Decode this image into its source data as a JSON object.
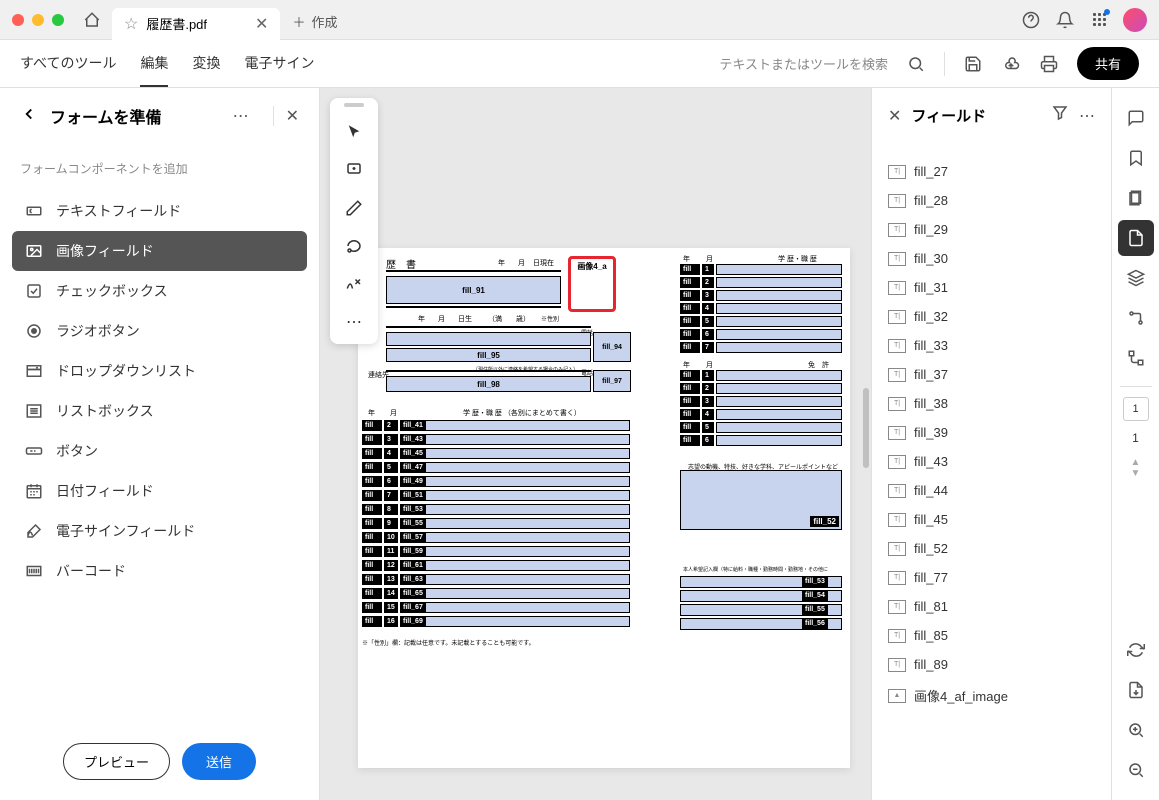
{
  "titlebar": {
    "tab_title": "履歴書.pdf",
    "new_tab_label": "作成"
  },
  "toolbar": {
    "menu": [
      "すべてのツール",
      "編集",
      "変換",
      "電子サイン"
    ],
    "search_placeholder": "テキストまたはツールを検索",
    "share_label": "共有"
  },
  "left_panel": {
    "title": "フォームを準備",
    "section_label": "フォームコンポーネントを追加",
    "components": [
      "テキストフィールド",
      "画像フィールド",
      "チェックボックス",
      "ラジオボタン",
      "ドロップダウンリスト",
      "リストボックス",
      "ボタン",
      "日付フィールド",
      "電子サインフィールド",
      "バーコード"
    ],
    "preview_label": "プレビュー",
    "submit_label": "送信"
  },
  "canvas": {
    "doc_title": "歴　書",
    "header_labels": {
      "year": "年",
      "month": "月",
      "day": "日現在",
      "birth": "日生",
      "age": "（満　　歳）",
      "tel": "連絡先",
      "note": "（現住所以外に連絡を希望する場合のみ記入）"
    },
    "section_labels": {
      "history": "学 歴・職 歴 （各別にまとめて書く）",
      "history2": "学 歴・職 歴",
      "license": "免　許",
      "motivation": "志望の動機、特技、好きな学科、アピールポイントなど",
      "requests": "本人希望記入欄（特に給料・職種・勤務時間・勤務地・その他に",
      "footnote": "※「性別」欄：記載は任意です。未記載とすることも可能です。"
    },
    "fields": {
      "f91": "fill_91",
      "f95": "fill_95",
      "f98": "fill_98",
      "f94": "fill_94",
      "f97": "fill_97",
      "f52": "fill_52",
      "img": "画像4_a"
    }
  },
  "right_panel": {
    "title": "フィールド",
    "fields": [
      "fill_27",
      "fill_28",
      "fill_29",
      "fill_30",
      "fill_31",
      "fill_32",
      "fill_33",
      "fill_37",
      "fill_38",
      "fill_39",
      "fill_43",
      "fill_44",
      "fill_45",
      "fill_52",
      "fill_77",
      "fill_81",
      "fill_85",
      "fill_89",
      "画像4_af_image"
    ]
  },
  "right_rail": {
    "page_current": "1",
    "page_total": "1"
  }
}
